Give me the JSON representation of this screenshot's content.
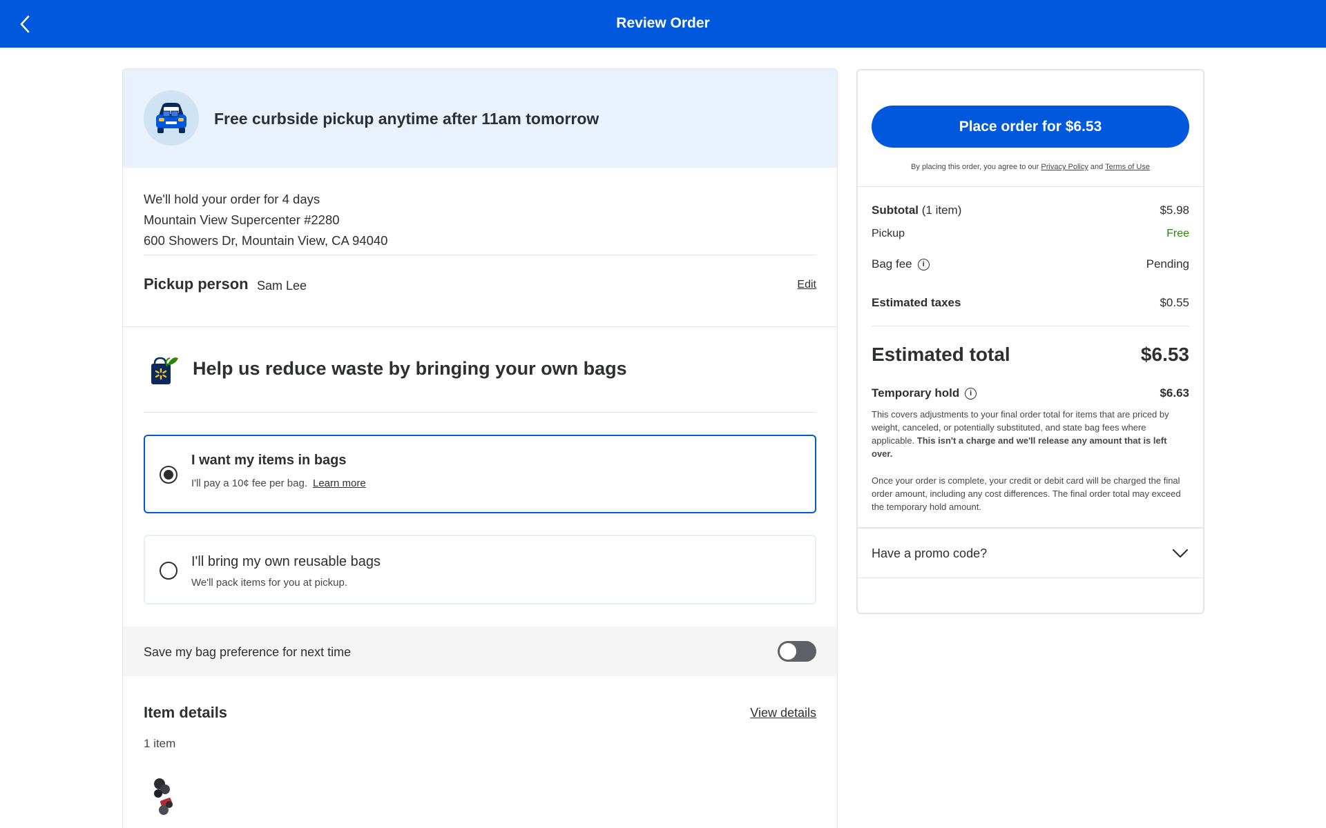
{
  "header": {
    "title": "Review Order",
    "back_icon": "chevron-left-icon"
  },
  "pickup": {
    "banner_text": "Free curbside pickup anytime after 11am tomorrow",
    "hold_text": "We'll hold your order for 4 days",
    "store_name": "Mountain View Supercenter #2280",
    "store_address": "600 Showers Dr, Mountain View, CA 94040",
    "person_label": "Pickup person",
    "person_name": "Sam Lee",
    "edit_label": "Edit"
  },
  "bags": {
    "heading": "Help us reduce waste by bringing your own bags",
    "options": [
      {
        "title": "I want my items in bags",
        "subtitle": "I'll pay a 10¢ fee per bag.",
        "link": "Learn more",
        "selected": true
      },
      {
        "title": "I'll bring my own reusable bags",
        "subtitle": "We'll pack items for you at pickup.",
        "selected": false
      }
    ],
    "save_pref_label": "Save my bag preference for next time",
    "save_pref_on": false
  },
  "items": {
    "title": "Item details",
    "view_details": "View details",
    "count": "1 item"
  },
  "summary": {
    "place_order": "Place order for $6.53",
    "agree_prefix": "By placing this order, you agree to our",
    "privacy": "Privacy Policy",
    "and": "and",
    "terms": "Terms of Use",
    "subtotal_label": "Subtotal",
    "subtotal_count": "(1 item)",
    "subtotal_value": "$5.98",
    "pickup_label": "Pickup",
    "pickup_value": "Free",
    "bag_fee_label": "Bag fee",
    "bag_fee_value": "Pending",
    "taxes_label": "Estimated taxes",
    "taxes_value": "$0.55",
    "total_label": "Estimated total",
    "total_value": "$6.53",
    "hold_label": "Temporary hold",
    "hold_value": "$6.63",
    "hold_desc": "This covers adjustments to your final order total for items that are priced by weight, canceled, or potentially substituted, and state bag fees where applicable.",
    "hold_desc_bold": "This isn't a charge and we'll release any amount that is left over.",
    "hold_note": "Once your order is complete, your credit or debit card will be charged the final order amount, including any cost differences. The final order total may exceed the temporary hold amount.",
    "promo_label": "Have a promo code?"
  },
  "colors": {
    "brand_blue": "#0058dc",
    "free_green": "#2a8703",
    "banner_bg": "#e9f1fc"
  }
}
